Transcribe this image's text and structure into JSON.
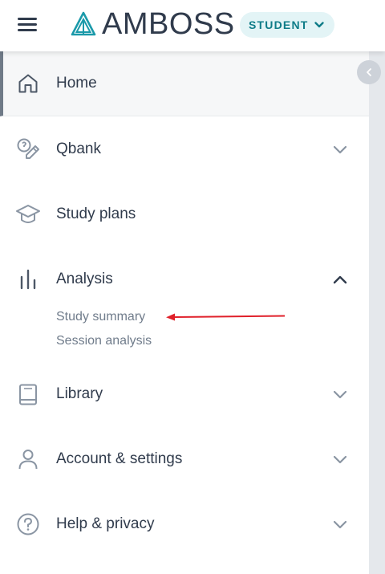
{
  "header": {
    "brand": "AMBOSS",
    "role_label": "STUDENT"
  },
  "nav": {
    "home": "Home",
    "qbank": "Qbank",
    "study_plans": "Study plans",
    "analysis": "Analysis",
    "analysis_sub": [
      "Study summary",
      "Session analysis"
    ],
    "library": "Library",
    "account": "Account & settings",
    "help": "Help & privacy"
  },
  "colors": {
    "brand_teal": "#1b9aaa",
    "text": "#303b4c",
    "annotation_arrow": "#e0202a"
  },
  "icons": [
    "menu-icon",
    "amboss-logo-icon",
    "chevron-down-icon",
    "chevron-left-icon",
    "home-icon",
    "qbank-icon",
    "graduation-cap-icon",
    "bar-chart-icon",
    "book-icon",
    "user-icon",
    "help-circle-icon"
  ]
}
